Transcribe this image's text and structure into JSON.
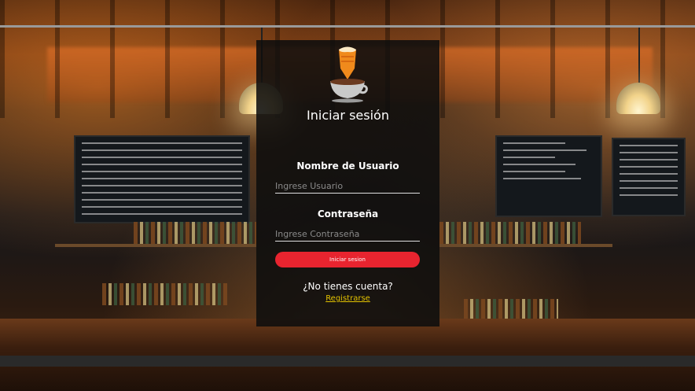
{
  "login": {
    "title": "Iniciar sesión",
    "username_label": "Nombre de Usuario",
    "username_placeholder": "Ingrese Usuario",
    "username_value": "",
    "password_label": "Contraseña",
    "password_placeholder": "Ingrese Contraseña",
    "password_value": "",
    "submit_label": "Iniciar sesion",
    "no_account_text": "¿No tienes cuenta?",
    "register_label": "Registrarse"
  },
  "icons": {
    "logo": "beer-cup-logo-icon"
  },
  "colors": {
    "panel_background": "#0e0e0e",
    "accent_button": "#e8242f",
    "link": "#e3c300",
    "beer": "#f08a1c",
    "cup": "#c9c9c9"
  }
}
